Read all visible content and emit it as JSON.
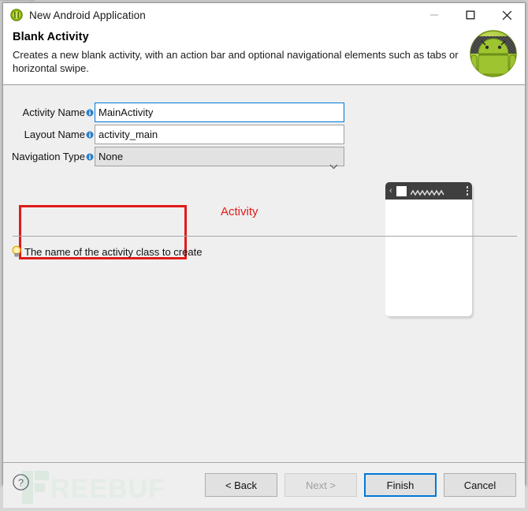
{
  "window": {
    "title": "New Android Application",
    "icon": "android-circle-icon",
    "controls": {
      "minimize": "minimize-icon",
      "maximize": "maximize-icon",
      "close": "close-icon"
    }
  },
  "header": {
    "title": "Blank Activity",
    "description": "Creates a new blank activity, with an action bar and optional navigational elements such as tabs or horizontal swipe.",
    "logo": "android-robot-icon"
  },
  "form": {
    "fields": [
      {
        "label": "Activity Name",
        "value": "MainActivity",
        "info_icon": "info-icon",
        "type": "text",
        "focused": true
      },
      {
        "label": "Layout Name",
        "value": "activity_main",
        "info_icon": "info-icon",
        "type": "text",
        "focused": false
      },
      {
        "label": "Navigation Type",
        "value": "None",
        "info_icon": "info-icon",
        "type": "combo",
        "focused": false
      }
    ]
  },
  "annotation": {
    "label": "Activity",
    "color": "#e01b1b"
  },
  "preview": {
    "name": "blank-activity-preview",
    "actionbar_color": "#3f3f3f",
    "back_glyph": "‹",
    "title_placeholder": "zigzag-placeholder",
    "overflow": "overflow-menu-icon"
  },
  "hint": {
    "icon": "lightbulb-icon",
    "text": "The name of the activity class to create"
  },
  "footer": {
    "help": "?",
    "watermark": "FREEBUF",
    "buttons": [
      {
        "label": "< Back",
        "state": "enabled",
        "name": "back-button"
      },
      {
        "label": "Next >",
        "state": "disabled",
        "name": "next-button"
      },
      {
        "label": "Finish",
        "state": "primary",
        "name": "finish-button"
      },
      {
        "label": "Cancel",
        "state": "enabled",
        "name": "cancel-button"
      }
    ]
  },
  "colors": {
    "accent": "#0078d7",
    "annotation": "#e01b1b",
    "android_green": "#a4c639",
    "window_bg": "#efefef"
  }
}
